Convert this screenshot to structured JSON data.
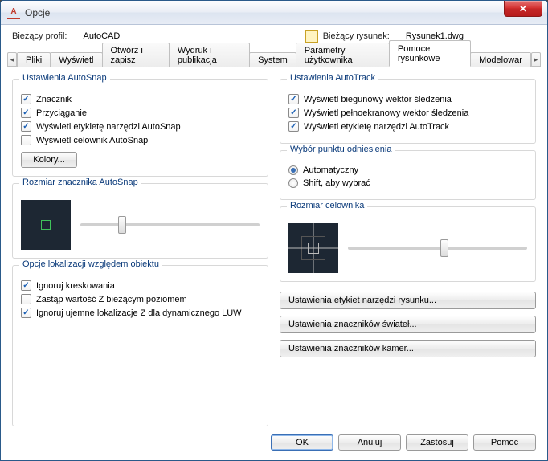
{
  "window": {
    "title": "Opcje"
  },
  "profile": {
    "label": "Bieżący profil:",
    "value": "AutoCAD"
  },
  "drawing": {
    "label": "Bieżący rysunek:",
    "value": "Rysunek1.dwg"
  },
  "tabs": {
    "pliki": "Pliki",
    "wyswietl": "Wyświetl",
    "otworz": "Otwórz i zapisz",
    "wydruk": "Wydruk i publikacja",
    "system": "System",
    "param": "Parametry użytkownika",
    "pomoce": "Pomoce rysunkowe",
    "modelowanie": "Modelowar"
  },
  "autosnap": {
    "title": "Ustawienia AutoSnap",
    "marker": "Znacznik",
    "przyciaganie": "Przyciąganie",
    "tooltips": "Wyświetl etykietę narzędzi AutoSnap",
    "aperture": "Wyświetl celownik AutoSnap",
    "colors_btn": "Kolory..."
  },
  "autotrack": {
    "title": "Ustawienia AutoTrack",
    "polar": "Wyświetl biegunowy wektor śledzenia",
    "fullscreen": "Wyświetl pełnoekranowy wektor śledzenia",
    "tooltips": "Wyświetl etykietę narzędzi AutoTrack"
  },
  "alignment": {
    "title": "Wybór punktu odniesienia",
    "auto": "Automatyczny",
    "shift": "Shift, aby wybrać"
  },
  "marker_size": {
    "title": "Rozmiar znacznika AutoSnap"
  },
  "aperture_size": {
    "title": "Rozmiar celownika"
  },
  "objloc": {
    "title": "Opcje lokalizacji względem obiektu",
    "hatch": "Ignoruj kreskowania",
    "replacez": "Zastąp wartość Z bieżącym poziomem",
    "negz": "Ignoruj ujemne lokalizacje Z dla dynamicznego LUW"
  },
  "rightbuttons": {
    "tooltips": "Ustawienia etykiet narzędzi rysunku...",
    "lights": "Ustawienia znaczników świateł...",
    "cameras": "Ustawienia znaczników kamer..."
  },
  "footer": {
    "ok": "OK",
    "cancel": "Anuluj",
    "apply": "Zastosuj",
    "help": "Pomoc"
  }
}
